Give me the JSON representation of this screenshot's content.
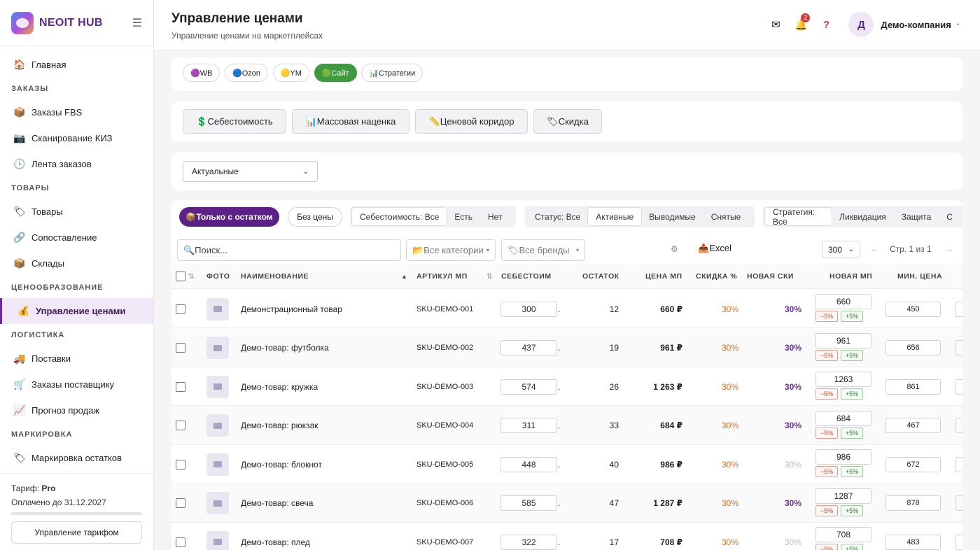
{
  "brand": {
    "name": "NEOIT HUB"
  },
  "nav": {
    "main": {
      "icon": "🏠",
      "label": "Главная"
    },
    "sec_orders": "ЗАКАЗЫ",
    "fbs": {
      "icon": "📦",
      "label": "Заказы FBS"
    },
    "kiz": {
      "icon": "📷",
      "label": "Сканирование КИЗ"
    },
    "feed": {
      "icon": "🕓",
      "label": "Лента заказов"
    },
    "sec_goods": "ТОВАРЫ",
    "goods": {
      "icon": "🏷",
      "label": "Товары"
    },
    "match": {
      "icon": "🔗",
      "label": "Сопоставление"
    },
    "stock": {
      "icon": "📦",
      "label": "Склады"
    },
    "sec_pricing": "ЦЕНООБРАЗОВАНИЕ",
    "prices": {
      "icon": "💰",
      "label": "Управление ценами"
    },
    "sec_logistics": "ЛОГИСТИКА",
    "supplies": {
      "icon": "🚚",
      "label": "Поставки"
    },
    "supplier": {
      "icon": "🛒",
      "label": "Заказы поставщику"
    },
    "forecast": {
      "icon": "📈",
      "label": "Прогноз продаж"
    },
    "sec_marking": "МАРКИРОВКА",
    "marking": {
      "icon": "🏷",
      "label": "Маркировка остатков"
    }
  },
  "footer": {
    "tariff_label": "Тариф:",
    "tariff": "Pro",
    "paid": "Оплачено до 31.12.2027",
    "manage": "Управление тарифом"
  },
  "header": {
    "title": "Управление ценами",
    "subtitle": "Управление ценами на маркетплейсах",
    "notif_count": "2",
    "avatar": "Д",
    "company": "Демо-компания"
  },
  "marketplaces": [
    "🟣WB",
    "🔵Ozon",
    "🟡YM",
    "🟢Сайт",
    "📊Стратегии"
  ],
  "actions": [
    "💲Себестоимость",
    "📊Массовая наценка",
    "📏Ценовой коридор",
    "🏷Скидка"
  ],
  "status_select": "Актуальные",
  "filters": {
    "only_stock": "📦Только с остатком",
    "no_price": "Без цены",
    "cost": [
      "Себестоимость: Все",
      "Есть",
      "Нет"
    ],
    "status": [
      "Статус: Все",
      "Активные",
      "Выводимые",
      "Снятые"
    ],
    "strategy": [
      "Стратегия: Все",
      "Ликвидация",
      "Защита",
      "С"
    ],
    "search_placeholder": "🔍Поиск...",
    "categories": "📂Все категории",
    "brands": "🏷Все бренды",
    "excel": "📤Excel",
    "per_page": "300",
    "page_info": "Стр. 1 из 1"
  },
  "columns": {
    "photo": "ФОТО",
    "name": "НАИМЕНОВАНИЕ",
    "sku": "АРТИКУЛ МП",
    "cost": "СЕБЕСТОИМ",
    "stock": "ОСТАТОК",
    "price": "ЦЕНА МП",
    "discount": "СКИДКА %",
    "new_discount": "НОВАЯ СКИ",
    "new_price": "НОВАЯ МП",
    "min_price": "МИН. ЦЕНА"
  },
  "adjust": {
    "minus": "−5%",
    "plus": "+5%"
  },
  "rows": [
    {
      "name": "Демонстрационный товар",
      "sku": "SKU-DEMO-001",
      "cost": "300",
      "stock": "12",
      "price": "660 ₽",
      "discount": "30%",
      "new_discount": "30%",
      "new_price": "660",
      "min_price": "450"
    },
    {
      "name": "Демо-товар: футболка",
      "sku": "SKU-DEMO-002",
      "cost": "437",
      "stock": "19",
      "price": "961 ₽",
      "discount": "30%",
      "new_discount": "30%",
      "new_price": "961",
      "min_price": "656"
    },
    {
      "name": "Демо-товар: кружка",
      "sku": "SKU-DEMO-003",
      "cost": "574",
      "stock": "26",
      "price": "1 263 ₽",
      "discount": "30%",
      "new_discount": "30%",
      "new_price": "1263",
      "min_price": "861"
    },
    {
      "name": "Демо-товар: рюкзак",
      "sku": "SKU-DEMO-004",
      "cost": "311",
      "stock": "33",
      "price": "684 ₽",
      "discount": "30%",
      "new_discount": "30%",
      "new_price": "684",
      "min_price": "467"
    },
    {
      "name": "Демо-товар: блокнот",
      "sku": "SKU-DEMO-005",
      "cost": "448",
      "stock": "40",
      "price": "986 ₽",
      "discount": "30%",
      "new_discount": "30%",
      "new_price": "986",
      "min_price": "672"
    },
    {
      "name": "Демо-товар: свеча",
      "sku": "SKU-DEMO-006",
      "cost": "585",
      "stock": "47",
      "price": "1 287 ₽",
      "discount": "30%",
      "new_discount": "30%",
      "new_price": "1287",
      "min_price": "878"
    },
    {
      "name": "Демо-товар: плед",
      "sku": "SKU-DEMO-007",
      "cost": "322",
      "stock": "17",
      "price": "708 ₽",
      "discount": "30%",
      "new_discount": "30%",
      "new_price": "708",
      "min_price": "483"
    }
  ]
}
